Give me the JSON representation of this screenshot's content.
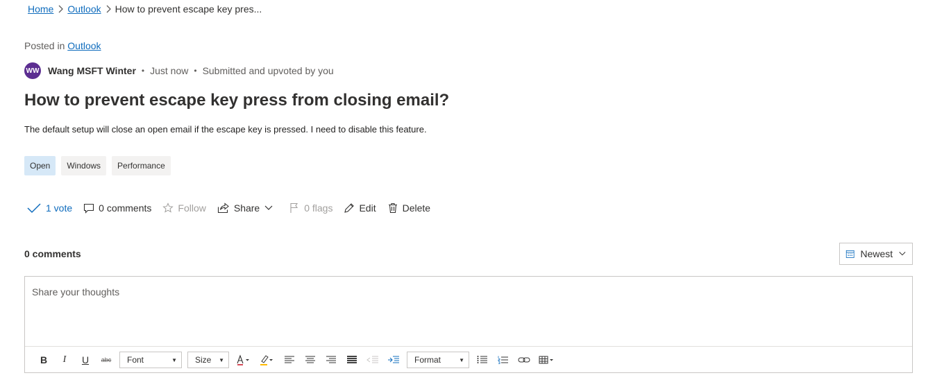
{
  "breadcrumb": {
    "home": "Home",
    "outlook": "Outlook",
    "current": "How to prevent escape key pres..."
  },
  "post": {
    "posted_in_label": "Posted in",
    "posted_in_link": "Outlook",
    "avatar_initials": "WW",
    "author": "Wang MSFT Winter",
    "time": "Just now",
    "status": "Submitted and upvoted by you",
    "title": "How to prevent escape key press from closing email?",
    "body": "The default setup will close an open email if the escape key is pressed. I need to disable this feature.",
    "tags": [
      "Open",
      "Windows",
      "Performance"
    ]
  },
  "actions": {
    "vote": "1 vote",
    "comments": "0 comments",
    "follow": "Follow",
    "share": "Share",
    "flags": "0 flags",
    "edit": "Edit",
    "delete": "Delete"
  },
  "comments": {
    "heading": "0 comments",
    "sort": "Newest",
    "placeholder": "Share your thoughts"
  },
  "toolbar": {
    "font": "Font",
    "size": "Size",
    "format": "Format",
    "strike_label": "abc"
  },
  "colors": {
    "accent": "#0f6cbd",
    "avatar": "#5c2e91",
    "tag_open": "#d6e8f7"
  }
}
